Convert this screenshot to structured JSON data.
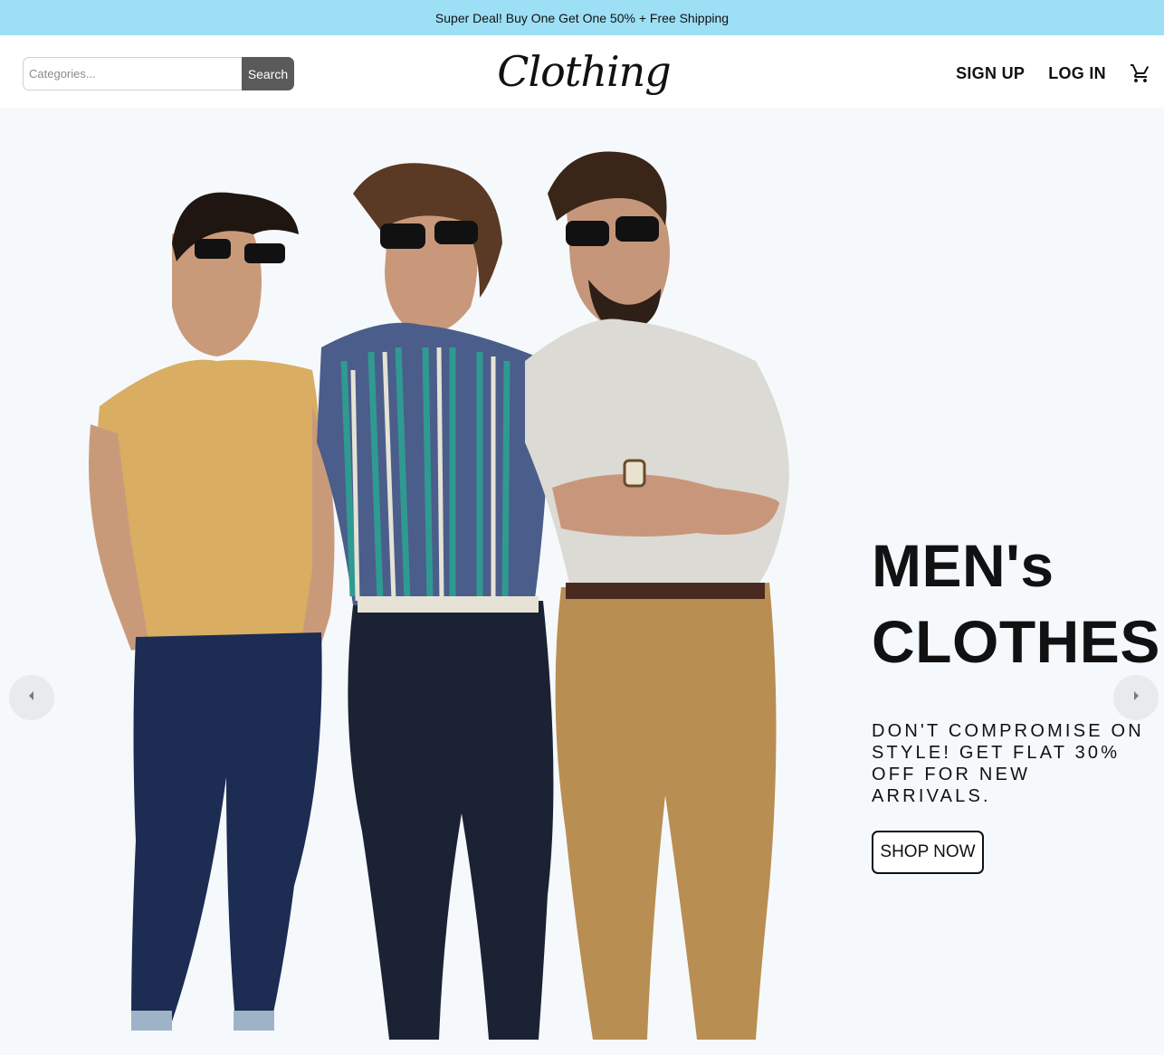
{
  "promo": {
    "text": "Super Deal! Buy One Get One 50% + Free Shipping"
  },
  "header": {
    "search": {
      "placeholder": "Categories...",
      "button_label": "Search"
    },
    "logo_text": "Clothing",
    "nav": {
      "signup": "SIGN UP",
      "login": "LOG IN",
      "cart_icon": "shopping-cart-icon"
    }
  },
  "hero": {
    "headline_line1": "MEN's",
    "headline_line2": "CLOTHES",
    "tagline": "DON'T COMPROMISE ON STYLE! GET FLAT 30% OFF FOR NEW ARRIVALS.",
    "cta_label": "SHOP NOW",
    "prev_icon": "chevron-left-icon",
    "next_icon": "chevron-right-icon"
  },
  "colors": {
    "promo_bg": "#9ddff5",
    "hero_bg": "#f5f9fc",
    "search_button_bg": "#5a5a5a",
    "text": "#111111"
  }
}
